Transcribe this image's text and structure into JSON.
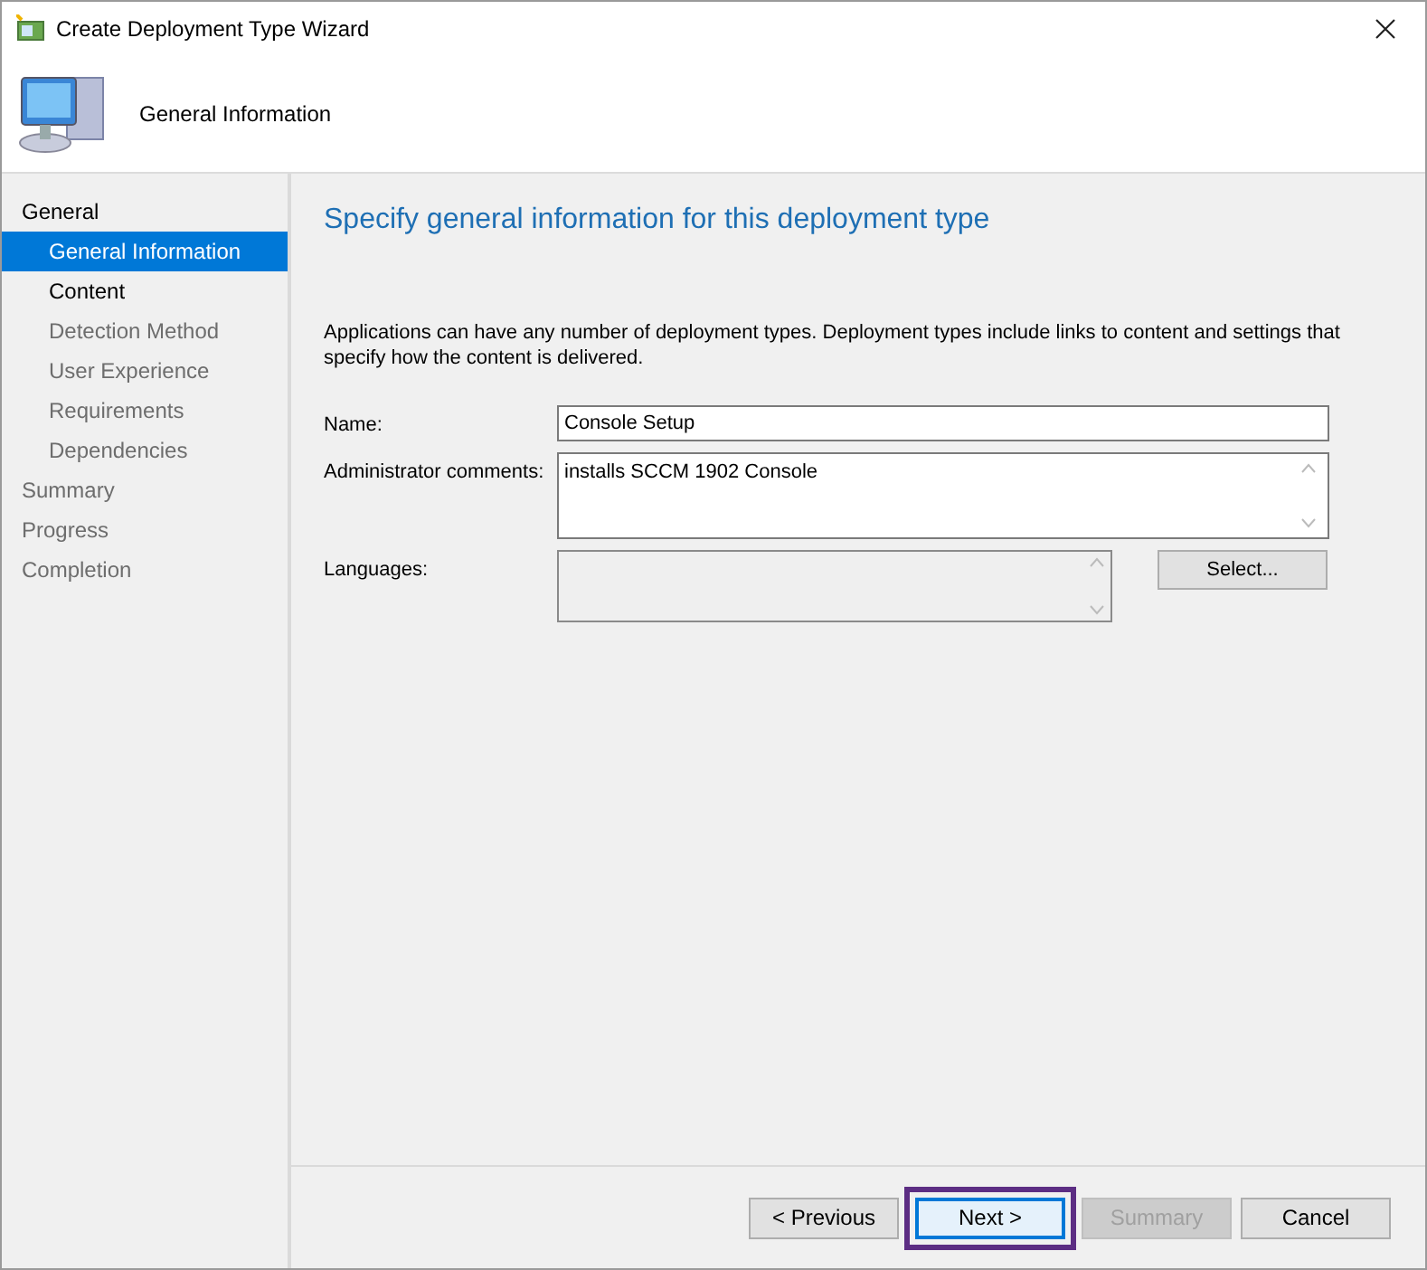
{
  "window": {
    "title": "Create Deployment Type Wizard"
  },
  "header": {
    "title": "General Information"
  },
  "sidebar": {
    "items": [
      {
        "label": "General",
        "selected": false,
        "disabled": false,
        "children": [
          {
            "label": "General Information",
            "selected": true,
            "disabled": false
          },
          {
            "label": "Content",
            "selected": false,
            "disabled": false
          },
          {
            "label": "Detection Method",
            "selected": false,
            "disabled": true
          },
          {
            "label": "User Experience",
            "selected": false,
            "disabled": true
          },
          {
            "label": "Requirements",
            "selected": false,
            "disabled": true
          },
          {
            "label": "Dependencies",
            "selected": false,
            "disabled": true
          }
        ]
      },
      {
        "label": "Summary",
        "selected": false,
        "disabled": true
      },
      {
        "label": "Progress",
        "selected": false,
        "disabled": true
      },
      {
        "label": "Completion",
        "selected": false,
        "disabled": true
      }
    ]
  },
  "page": {
    "heading": "Specify general information for this deployment type",
    "description": "Applications can have any number of deployment types. Deployment types include links to content and settings that specify how the content is delivered.",
    "fields": [
      {
        "kind": "text",
        "label": "Name:",
        "value": "Console Setup"
      },
      {
        "kind": "textarea",
        "label": "Administrator comments:",
        "value": "installs SCCM 1902 Console"
      },
      {
        "kind": "list",
        "label": "Languages:",
        "button": "Select..."
      }
    ]
  },
  "buttons": [
    {
      "label": "< Previous",
      "disabled": false,
      "highlighted": false
    },
    {
      "label": "Next >",
      "disabled": false,
      "highlighted": true
    },
    {
      "label": "Summary",
      "disabled": true,
      "highlighted": false
    },
    {
      "label": "Cancel",
      "disabled": false,
      "highlighted": false
    }
  ]
}
